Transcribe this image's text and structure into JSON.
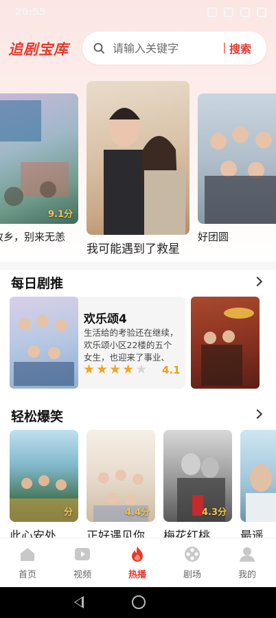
{
  "status_bar": {
    "time": "20:55"
  },
  "header": {
    "logo": "追剧宝库",
    "search": {
      "placeholder": "请输入关键字",
      "button_label": "搜索"
    }
  },
  "carousel": [
    {
      "title": "故乡，别来无恙",
      "score": "9.1分"
    },
    {
      "title": "我可能遇到了救星",
      "score": ""
    },
    {
      "title": "好团圆",
      "score": ""
    }
  ],
  "daily": {
    "section_title": "每日剧推",
    "item": {
      "title": "欢乐颂4",
      "desc_line1": "生活给的考验还在继续，",
      "desc_line2": "欢乐颂小区22楼的五个",
      "desc_line3": "女生，也迎来了事业、",
      "rating": "4.1",
      "stars_filled": 4,
      "stars_total": 5
    }
  },
  "comedy": {
    "section_title": "轻松爆笑",
    "items": [
      {
        "title": "此心安处",
        "score": "分"
      },
      {
        "title": "正好遇见你",
        "score": "4.4分"
      },
      {
        "title": "梅花红桃",
        "score": "4.3分"
      },
      {
        "title": "最遥",
        "score": ""
      }
    ]
  },
  "bottom_nav": {
    "items": [
      {
        "label": "首页",
        "icon": "home-icon"
      },
      {
        "label": "视频",
        "icon": "video-icon"
      },
      {
        "label": "热播",
        "icon": "fire-icon"
      },
      {
        "label": "剧场",
        "icon": "film-reel-icon"
      },
      {
        "label": "我的",
        "icon": "profile-icon"
      }
    ],
    "active_index": 2
  },
  "colors": {
    "accent": "#e6392c",
    "star": "#f2a51e"
  }
}
